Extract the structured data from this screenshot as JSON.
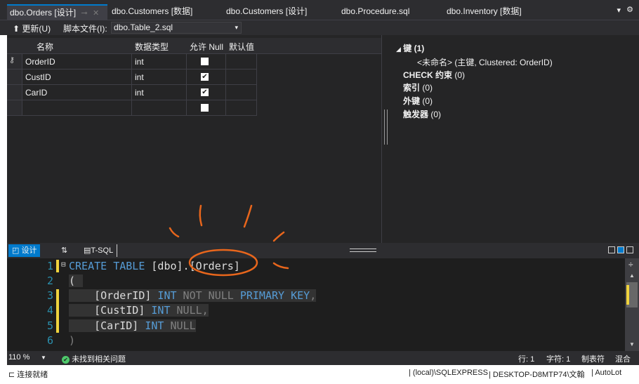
{
  "doc_tabs": [
    {
      "label": "dbo.Orders [设计]",
      "active": true
    },
    {
      "label": "dbo.Customers [数据]"
    },
    {
      "label": "dbo.Customers [设计]"
    },
    {
      "label": "dbo.Procedure.sql"
    },
    {
      "label": "dbo.Inventory [数据]"
    }
  ],
  "toolbar": {
    "update_label": "更新(U)",
    "script_file_label": "脚本文件(I):",
    "script_file_value": "dbo.Table_2.sql"
  },
  "grid": {
    "headers": {
      "name": "名称",
      "type": "数据类型",
      "allow_null": "允许 Null",
      "default": "默认值"
    },
    "rows": [
      {
        "name": "OrderID",
        "type": "int",
        "allow_null": false,
        "is_key": true
      },
      {
        "name": "CustID",
        "type": "int",
        "allow_null": true
      },
      {
        "name": "CarID",
        "type": "int",
        "allow_null": true
      },
      {
        "name": "",
        "type": "",
        "allow_null": false
      }
    ]
  },
  "props": {
    "keys_label": "键 (1)",
    "key_entry": "<未命名>   (主键, Clustered: OrderID)",
    "check_label": "CHECK 约束",
    "check_count": "(0)",
    "index_label": "索引",
    "index_count": "(0)",
    "fk_label": "外键",
    "fk_count": "(0)",
    "trigger_label": "触发器",
    "trigger_count": "(0)"
  },
  "pane_tabs": {
    "design": "设计",
    "tsql": "T-SQL"
  },
  "code_lines": [
    "1",
    "2",
    "3",
    "4",
    "5",
    "6"
  ],
  "code": {
    "l1_create": "CREATE TABLE",
    "l1_schema": " [dbo].",
    "l1_table": "[Orders]",
    "l2": "(",
    "l3_col": "[OrderID]",
    "l3_type": " INT",
    "l3_notnull": " NOT NULL",
    "l3_pk": " PRIMARY KEY",
    "l3_comma": ",",
    "l4_col": "[CustID]",
    "l4_type": " INT",
    "l4_null": " NULL",
    "l4_comma": ",",
    "l5_col": "[CarID]",
    "l5_type": " INT",
    "l5_null": " NULL",
    "l6": ")"
  },
  "editor_status": {
    "zoom": "110 %",
    "issues": "未找到相关问题",
    "line": "行: 1",
    "char": "字符: 1",
    "tab": "制表符",
    "mixed": "混合"
  },
  "statusbar": {
    "ready": "连接就绪",
    "server": "(local)\\SQLEXPRESS",
    "machine": "DESKTOP-D8MTP74\\文翰",
    "db": "AutoLot"
  },
  "colors": {
    "accent": "#007acc",
    "annotation": "#e8661c",
    "modified": "#efd33e"
  }
}
